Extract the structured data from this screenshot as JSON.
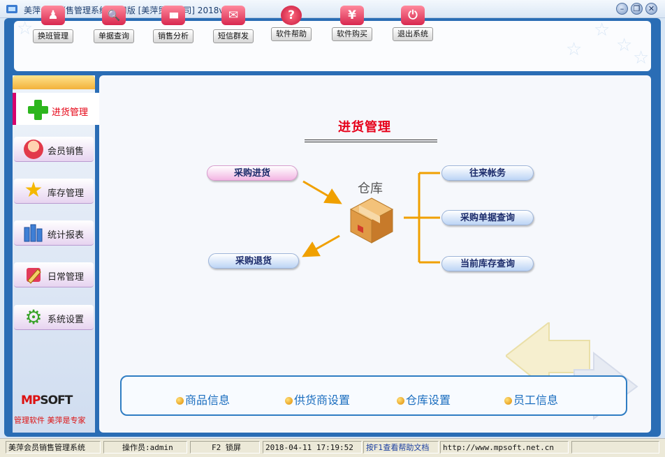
{
  "window": {
    "title": "美萍会员销售管理系统 试用版 [美萍贸易公司] 2018v3.1",
    "controls": {
      "minimize": "–",
      "restore": "❐",
      "close": "✕"
    }
  },
  "toolbar": [
    {
      "label": "换班管理",
      "icon": "user-switch-icon",
      "glyph": "♟"
    },
    {
      "label": "单据查询",
      "icon": "magnifier-icon",
      "glyph": "🔍"
    },
    {
      "label": "销售分析",
      "icon": "bar-chart-icon",
      "glyph": "▮▮▮"
    },
    {
      "label": "短信群发",
      "icon": "envelope-icon",
      "glyph": "✉"
    },
    {
      "label": "软件帮助",
      "icon": "help-icon",
      "glyph": "?"
    },
    {
      "label": "软件购买",
      "icon": "yen-icon",
      "glyph": "¥"
    },
    {
      "label": "退出系统",
      "icon": "power-icon",
      "glyph": "⏻"
    }
  ],
  "sidebar": {
    "active": {
      "label": "进货管理",
      "icon": "plus-icon"
    },
    "items": [
      {
        "label": "会员销售",
        "icon": "member-icon"
      },
      {
        "label": "库存管理",
        "icon": "star-icon"
      },
      {
        "label": "统计报表",
        "icon": "report-bars-icon"
      },
      {
        "label": "日常管理",
        "icon": "pencil-icon"
      },
      {
        "label": "系统设置",
        "icon": "gear-icon"
      }
    ],
    "logo": {
      "mp": "MP",
      "soft": "SOFT"
    },
    "slogan": "管理软件 美萍是专家"
  },
  "main": {
    "title": "进货管理",
    "hub_label": "仓库",
    "hub_icon": "warehouse-box-icon",
    "left_buttons": [
      "采购进货",
      "采购退货"
    ],
    "right_buttons": [
      "往来帐务",
      "采购单据查询",
      "当前库存查询"
    ],
    "bottom_links": [
      "商品信息",
      "供货商设置",
      "仓库设置",
      "员工信息"
    ],
    "colors": {
      "title": "#e6001a",
      "arrow": "#f0a000",
      "link": "#1a6dbf"
    }
  },
  "statusbar": {
    "app": "美萍会员销售管理系统",
    "operator": "操作员:admin",
    "lock": "F2 锁屏",
    "datetime": "2018-04-11 17:19:52",
    "help": "按F1查看帮助文档",
    "url": "http://www.mpsoft.net.cn"
  }
}
